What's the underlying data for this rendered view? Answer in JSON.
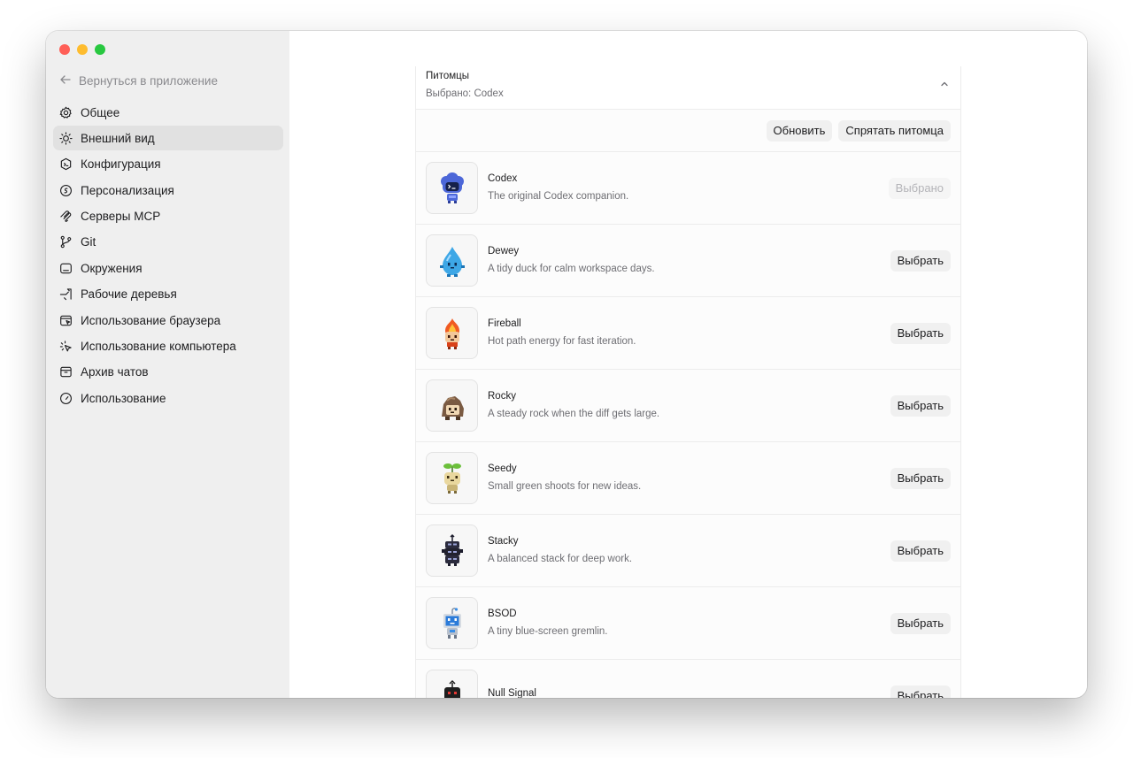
{
  "sidebar": {
    "back_label": "Вернуться в приложение",
    "items": [
      {
        "label": "Общее",
        "icon": "gear-icon"
      },
      {
        "label": "Внешний вид",
        "icon": "sun-icon",
        "active": true
      },
      {
        "label": "Конфигурация",
        "icon": "config-icon"
      },
      {
        "label": "Персонализация",
        "icon": "personalization-icon"
      },
      {
        "label": "Серверы MCP",
        "icon": "mcp-icon"
      },
      {
        "label": "Git",
        "icon": "git-branch-icon"
      },
      {
        "label": "Окружения",
        "icon": "environment-icon"
      },
      {
        "label": "Рабочие деревья",
        "icon": "worktree-icon"
      },
      {
        "label": "Использование браузера",
        "icon": "browser-icon"
      },
      {
        "label": "Использование компьютера",
        "icon": "computer-use-icon"
      },
      {
        "label": "Архив чатов",
        "icon": "archive-icon"
      },
      {
        "label": "Использование",
        "icon": "gauge-icon"
      }
    ]
  },
  "panel": {
    "title": "Питомцы",
    "subtitle": "Выбрано: Codex",
    "refresh_label": "Обновить",
    "hide_label": "Спрятать питомца"
  },
  "pets": [
    {
      "name": "Codex",
      "description": "The original Codex companion.",
      "action": "Выбрано",
      "selected": true,
      "icon": "codex-pet-icon"
    },
    {
      "name": "Dewey",
      "description": "A tidy duck for calm workspace days.",
      "action": "Выбрать",
      "icon": "dewey-pet-icon"
    },
    {
      "name": "Fireball",
      "description": "Hot path energy for fast iteration.",
      "action": "Выбрать",
      "icon": "fireball-pet-icon"
    },
    {
      "name": "Rocky",
      "description": "A steady rock when the diff gets large.",
      "action": "Выбрать",
      "icon": "rocky-pet-icon"
    },
    {
      "name": "Seedy",
      "description": "Small green shoots for new ideas.",
      "action": "Выбрать",
      "icon": "seedy-pet-icon"
    },
    {
      "name": "Stacky",
      "description": "A balanced stack for deep work.",
      "action": "Выбрать",
      "icon": "stacky-pet-icon"
    },
    {
      "name": "BSOD",
      "description": "A tiny blue-screen gremlin.",
      "action": "Выбрать",
      "icon": "bsod-pet-icon"
    },
    {
      "name": "Null Signal",
      "description": "",
      "action": "Выбрать",
      "icon": "null-signal-pet-icon"
    }
  ],
  "colors": {
    "sidebar_bg": "#efefef",
    "active_item_bg": "#e1e1e1",
    "button_bg": "#f0f0f0"
  }
}
